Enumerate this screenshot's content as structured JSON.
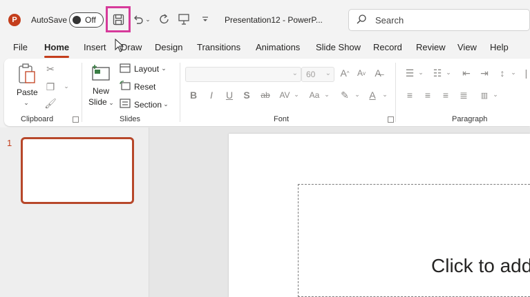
{
  "titlebar": {
    "app_icon_letter": "P",
    "autosave_label": "AutoSave",
    "autosave_state": "Off",
    "doc_title": "Presentation12 - PowerP...",
    "search_placeholder": "Search"
  },
  "quick_access": {
    "icons": [
      "save-icon",
      "undo-icon",
      "undo-dropdown-icon",
      "redo-icon",
      "present-icon",
      "customize-dropdown-icon"
    ]
  },
  "tabs": [
    "File",
    "Home",
    "Insert",
    "Draw",
    "Design",
    "Transitions",
    "Animations",
    "Slide Show",
    "Record",
    "Review",
    "View",
    "Help"
  ],
  "active_tab": "Home",
  "ribbon": {
    "clipboard": {
      "paste_label": "Paste",
      "group_label": "Clipboard"
    },
    "slides": {
      "new_slide_line1": "New",
      "new_slide_line2": "Slide",
      "layout_label": "Layout",
      "reset_label": "Reset",
      "section_label": "Section",
      "group_label": "Slides"
    },
    "font": {
      "font_size": "60",
      "group_label": "Font"
    },
    "paragraph": {
      "group_label": "Paragraph"
    }
  },
  "thumbnails": {
    "slide_number": "1"
  },
  "slide": {
    "placeholder_text": "Click to add"
  },
  "colors": {
    "accent": "#c43e1c",
    "highlight": "#d63a9a",
    "thumb_border": "#b7472a"
  }
}
